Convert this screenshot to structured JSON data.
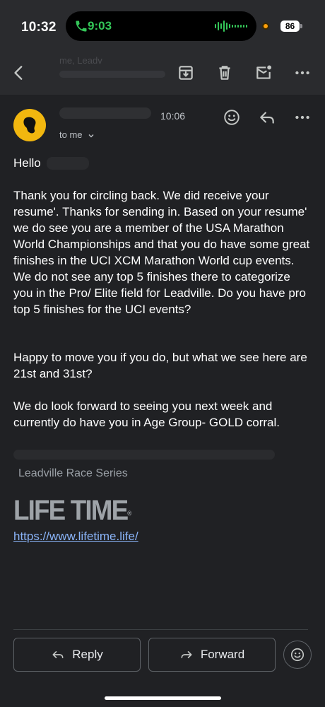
{
  "status_bar": {
    "time": "10:32",
    "call_time": "9:03",
    "battery": "86"
  },
  "toolbar": {
    "back_icon": "back-arrow-icon",
    "archive_icon": "archive-icon",
    "delete_icon": "trash-icon",
    "mark_unread_icon": "mail-unread-icon",
    "more_icon": "more-icon",
    "behind_sender": "me, Leadv"
  },
  "message": {
    "time": "10:06",
    "to_label": "to me",
    "greeting": "Hello",
    "paragraphs": [
      "Thank you for circling back. We did receive your resume'. Thanks for sending in. Based on your resume' we do see you are a member of the USA Marathon World Championships and that you do have some great finishes in the UCI XCM Marathon World cup events. We do not see any top 5 finishes there to categorize you in the Pro/ Elite field for Leadville.  Do you have pro top 5 finishes for the UCI events?",
      "Happy to move you if you do, but what we see here are 21st and 31st?",
      "We do look forward to seeing you next week and currently do have you in Age Group- GOLD corral."
    ],
    "signature_org": "Leadville Race Series",
    "logo_text": "LIFE TIME",
    "logo_mark": "®",
    "link": "https://www.lifetime.life/"
  },
  "actions": {
    "reply_label": "Reply",
    "forward_label": "Forward"
  },
  "colors": {
    "background": "#202124",
    "avatar": "#f2b70f",
    "link": "#8ab4f8",
    "call_green": "#34c759"
  }
}
